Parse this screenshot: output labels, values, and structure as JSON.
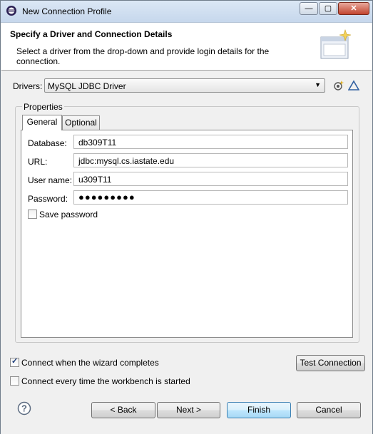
{
  "window": {
    "title": "New Connection Profile",
    "controls": {
      "minimize": "—",
      "maximize": "▢",
      "close": "✕"
    }
  },
  "header": {
    "title": "Specify a Driver and Connection Details",
    "description": "Select a driver from the drop-down and provide login details for the connection."
  },
  "drivers": {
    "label": "Drivers:",
    "selected": "MySQL JDBC Driver"
  },
  "properties": {
    "group_label": "Properties",
    "tabs": [
      {
        "label": "General"
      },
      {
        "label": "Optional"
      }
    ],
    "fields": {
      "database": {
        "label": "Database:",
        "value": "db309T11"
      },
      "url": {
        "label": "URL:",
        "value": "jdbc:mysql.cs.iastate.edu"
      },
      "username": {
        "label": "User name:",
        "value": "u309T11"
      },
      "password": {
        "label": "Password:",
        "value": "●●●●●●●●●"
      }
    },
    "save_password": {
      "label": "Save password",
      "checked": false
    }
  },
  "options": {
    "connect_on_complete": {
      "label": "Connect when the wizard completes",
      "checked": true
    },
    "connect_every_time": {
      "label": "Connect every time the workbench is started",
      "checked": false
    }
  },
  "buttons": {
    "test_connection": "Test Connection",
    "back": "< Back",
    "next": "Next >",
    "finish": "Finish",
    "cancel": "Cancel"
  },
  "icons": {
    "app": "eclipse-icon",
    "new_driver": "new-driver-icon",
    "edit_driver": "edit-driver-icon",
    "help": "help-icon",
    "wizard": "wizard-banner-icon"
  },
  "colors": {
    "accent": "#3c7fb1",
    "title_gradient": "#c6d7ec"
  }
}
